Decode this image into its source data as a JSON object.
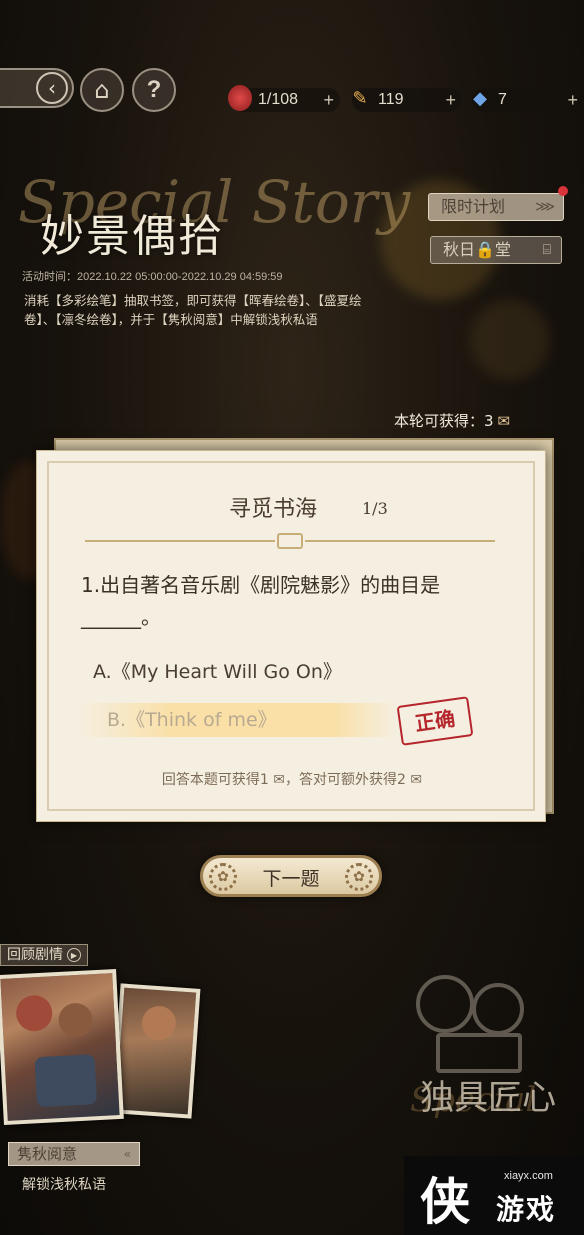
{
  "topbar": {
    "back_icon": "‹",
    "home_icon": "⌂",
    "help_icon": "?",
    "resources": [
      {
        "icon": "red-gem-icon",
        "value": "1/108",
        "plus": "+"
      },
      {
        "icon": "brush-icon",
        "value": "119",
        "plus": "+"
      },
      {
        "icon": "blue-crystal-icon",
        "value": "7",
        "plus": "+"
      }
    ]
  },
  "event": {
    "script_title": "Special Story",
    "title": "妙景偶拾",
    "time": "活动时间：2022.10.22 05:00:00-2022.10.29 04:59:59",
    "description": "消耗【多彩绘笔】抽取书签，即可获得【晖春绘卷】、【盛夏绘卷】、【凛冬绘卷】，并于【隽秋阅意】中解锁浅秋私语",
    "plan_button": "限时计划",
    "plan_arrows": "⋙",
    "autumn_button": "秋日🔒堂",
    "round_reward_label": "本轮可获得：3"
  },
  "quiz": {
    "title": "寻觅书海",
    "page": "1/3",
    "question": "1.出自著名音乐剧《剧院魅影》的曲目是______。",
    "options": [
      {
        "label": "A.《My Heart Will Go On》",
        "state": "normal"
      },
      {
        "label": "B.《Think of me》",
        "state": "correct"
      }
    ],
    "correct_stamp": "正确",
    "answer_reward": "回答本题可获得1 ✉，答对可额外获得2 ✉"
  },
  "next_button": "下一题",
  "bottom_left": {
    "review_label": "回顾剧情",
    "secret_button": "隽秋阅意",
    "secret_arrows": "«",
    "secret_sub": "解锁浅秋私语"
  },
  "bottom_right": {
    "craft_text": "独具匠心",
    "craft_script": "Special"
  },
  "watermark": {
    "mark": "侠",
    "site": "xiayx.com",
    "name": "游戏"
  },
  "colors": {
    "background": "#17120c",
    "card": "#f5efe1",
    "stamp_red": "#b5262c",
    "highlight": "#fadea0"
  }
}
